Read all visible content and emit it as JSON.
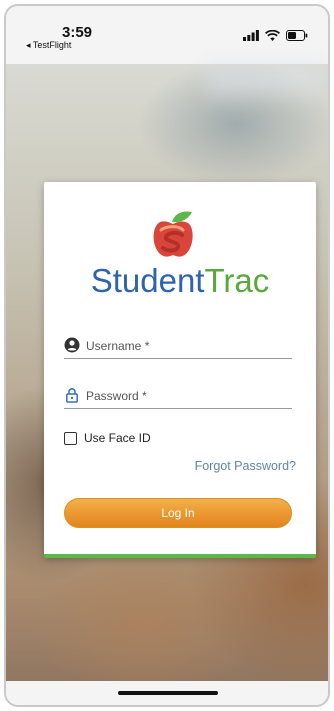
{
  "status_bar": {
    "time": "3:59",
    "back_app": "◂ TestFlight",
    "icons": [
      "signal-icon",
      "wifi-icon",
      "battery-icon"
    ]
  },
  "brand": {
    "part1": "Student",
    "part2": "Trac",
    "colors": {
      "part1": "#2f63ad",
      "part2": "#58a83c",
      "apple": "#d9453b",
      "leaf": "#5cb84a"
    }
  },
  "form": {
    "username_placeholder": "Username *",
    "username_value": "",
    "password_placeholder": "Password *",
    "password_value": "",
    "face_id_label": "Use Face ID",
    "face_id_checked": false,
    "forgot_label": "Forgot Password?",
    "login_label": "Log In"
  },
  "colors": {
    "accent_orange": "#eb9630",
    "card_border_green": "#5cb84a",
    "link": "#5f86a6"
  }
}
